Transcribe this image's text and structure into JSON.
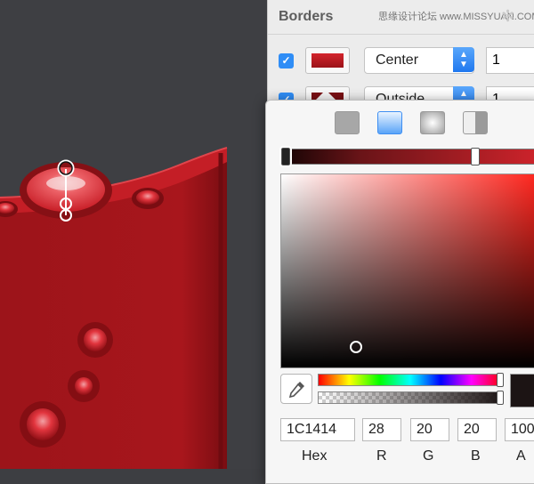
{
  "inspector": {
    "section_title": "Borders",
    "watermark": "思缘设计论坛 www.MISSYUAN.COM",
    "borders": [
      {
        "enabled": true,
        "color": "#b01a20",
        "position": "Center",
        "thickness": "1"
      },
      {
        "enabled": true,
        "color": "#7a0f13",
        "position": "Outside",
        "thickness": "1"
      }
    ]
  },
  "color_picker": {
    "fill_types": [
      "solid",
      "linear-gradient",
      "radial-gradient",
      "angular-gradient"
    ],
    "selected_fill_type": "linear-gradient",
    "gradient_stops": [
      "#140404",
      "#d3242c"
    ],
    "hue_color": "#ff1c14",
    "hex": "1C1414",
    "r": "28",
    "g": "20",
    "b": "20",
    "a": "100",
    "labels": {
      "hex": "Hex",
      "r": "R",
      "g": "G",
      "b": "B",
      "a": "A"
    }
  },
  "colors": {
    "canvas_bg": "#3e3f43",
    "artwork_red": "#a8161c",
    "accent_blue": "#2f8df6",
    "preview_color": "#1c1414"
  }
}
